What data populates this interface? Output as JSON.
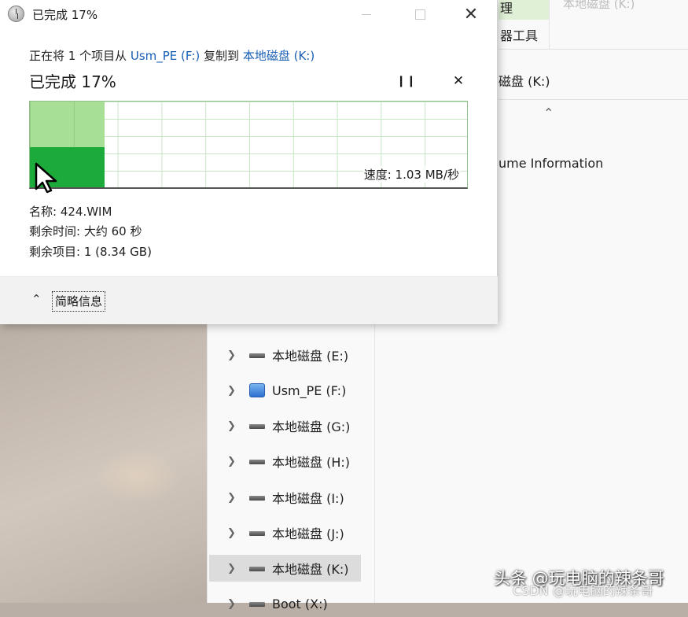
{
  "explorer": {
    "ribbon_tab_fragment": "理",
    "ribbon_tab_right": "本地磁盘 (K:)",
    "ribbon_tools": "器工具",
    "address": "磁盘 (K:)",
    "content_item": "ume Information",
    "nav_items": [
      {
        "label": "本地磁盘 (E:)",
        "icon": "drive-icon",
        "selected": false
      },
      {
        "label": "Usm_PE (F:)",
        "icon": "usb-drive-icon",
        "selected": false
      },
      {
        "label": "本地磁盘 (G:)",
        "icon": "drive-icon",
        "selected": false
      },
      {
        "label": "本地磁盘 (H:)",
        "icon": "drive-icon",
        "selected": false
      },
      {
        "label": "本地磁盘 (I:)",
        "icon": "drive-icon",
        "selected": false
      },
      {
        "label": "本地磁盘 (J:)",
        "icon": "drive-icon",
        "selected": false
      },
      {
        "label": "本地磁盘 (K:)",
        "icon": "drive-icon",
        "selected": true
      },
      {
        "label": "Boot (X:)",
        "icon": "drive-icon",
        "selected": false
      }
    ]
  },
  "dialog": {
    "title": "已完成 17%",
    "desc_prefix": "正在将 1 个项目从 ",
    "desc_source": "Usm_PE (F:)",
    "desc_middle": " 复制到 ",
    "desc_target": "本地磁盘 (K:)",
    "status": "已完成 17%",
    "progress_percent": 17,
    "speed_level_percent": 47,
    "speed_label": "速度: 1.03 MB/秒",
    "name_line": "名称: 424.WIM",
    "time_line": "剩余时间: 大约 60 秒",
    "items_line": "剩余项目: 1 (8.34 GB)",
    "details_toggle": "简略信息",
    "colors": {
      "progress_done": "#a8df97",
      "speed_fill": "#1caa3a",
      "link": "#1a5fb4"
    }
  },
  "watermark": {
    "primary": "头条 @玩电脑的辣条哥",
    "secondary": "CSDN @玩电脑的辣条哥"
  }
}
